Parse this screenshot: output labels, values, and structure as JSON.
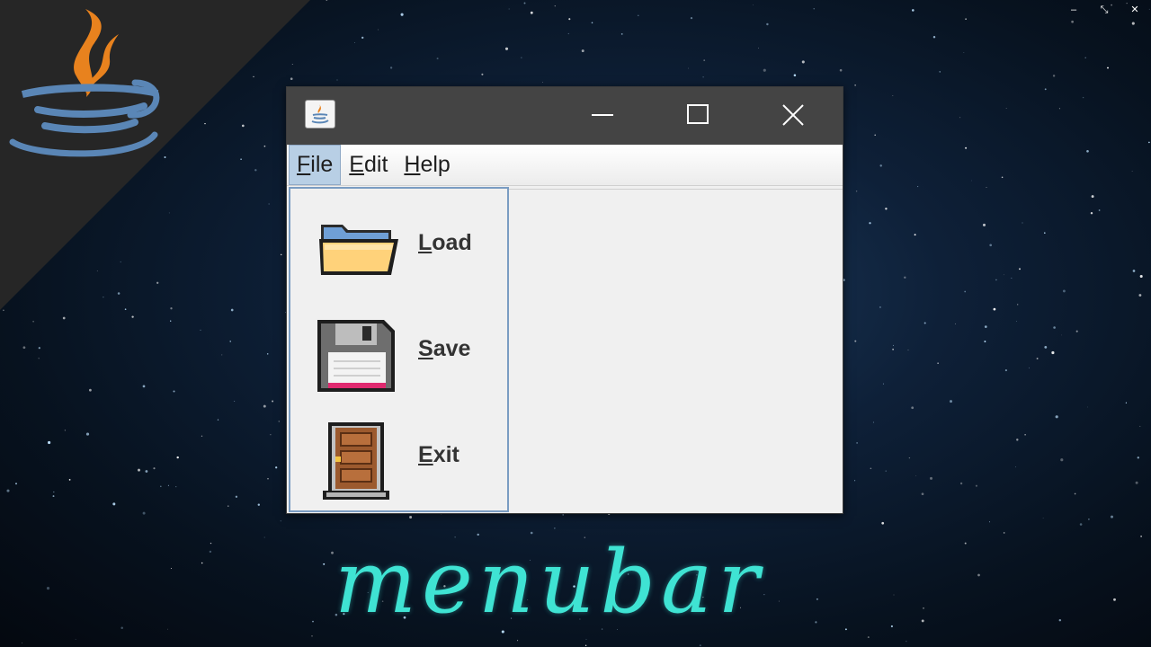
{
  "theme": {
    "titlebar_color": "#444444",
    "menu_active_color": "#b8cfe5",
    "caption_color": "#3fe3d3",
    "java_cup_orange": "#e8821e",
    "java_cup_blue": "#5a86b6"
  },
  "host_controls": {
    "minimize": "–",
    "restore": "⤡",
    "close": "✕"
  },
  "window": {
    "title_icon": "java-cup-icon",
    "buttons": [
      "minimize-icon",
      "maximize-icon",
      "close-icon"
    ]
  },
  "menubar": {
    "items": [
      {
        "mnemonic": "F",
        "rest": "ile",
        "active": true
      },
      {
        "mnemonic": "E",
        "rest": "dit",
        "active": false
      },
      {
        "mnemonic": "H",
        "rest": "elp",
        "active": false
      }
    ]
  },
  "file_menu": {
    "items": [
      {
        "icon": "folder-icon",
        "mnemonic": "L",
        "rest": "oad"
      },
      {
        "icon": "floppy-disk-icon",
        "mnemonic": "S",
        "rest": "ave"
      },
      {
        "icon": "door-icon",
        "mnemonic": "E",
        "rest": "xit"
      }
    ]
  },
  "caption": "menubar"
}
